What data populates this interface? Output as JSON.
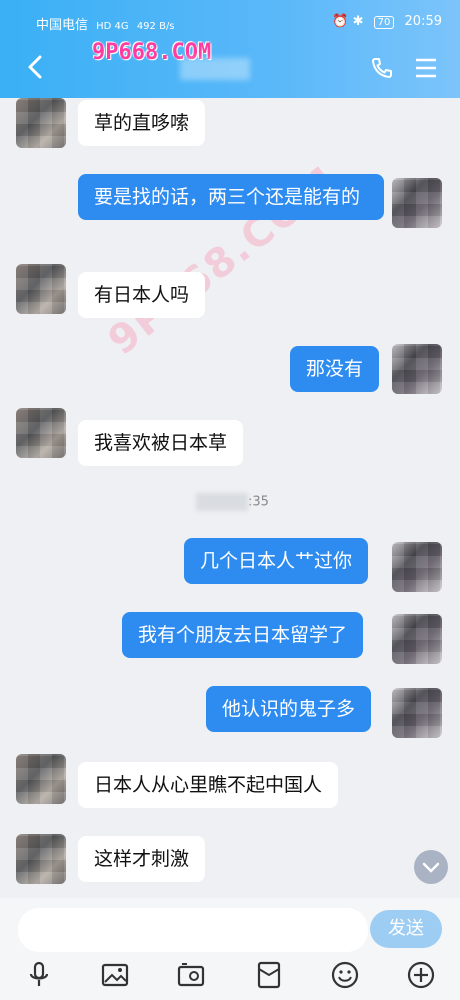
{
  "status_bar": {
    "carrier": "中国电信",
    "network": "HD 4G",
    "speed": "492 B/s",
    "battery": "70",
    "time": "20:59"
  },
  "header": {
    "watermark": "9P668.COM",
    "icons": [
      "back-arrow-icon",
      "phone-icon",
      "menu-icon"
    ]
  },
  "messages": [
    {
      "side": "in",
      "text": "草的直哆嗦"
    },
    {
      "side": "out",
      "text": "要是找的话，两三个还是能有的"
    },
    {
      "side": "in",
      "text": "有日本人吗"
    },
    {
      "side": "out",
      "text": "那没有"
    },
    {
      "side": "in",
      "text": "我喜欢被日本草"
    },
    {
      "side": "out",
      "text": "几个日本人艹过你"
    },
    {
      "side": "out",
      "text": "我有个朋友去日本留学了"
    },
    {
      "side": "out",
      "text": "他认识的鬼子多"
    },
    {
      "side": "in",
      "text": "日本人从心里瞧不起中国人"
    },
    {
      "side": "in",
      "text": "这样才刺激"
    }
  ],
  "timestamp_suffix": ":35",
  "watermark_diag": "9P668.COM",
  "input": {
    "placeholder": "",
    "send_label": "发送"
  },
  "toolbar": [
    "microphone-icon",
    "image-icon",
    "camera-icon",
    "red-packet-icon",
    "emoji-icon",
    "plus-icon"
  ],
  "colors": {
    "header": "#4fb4f7",
    "out_bubble": "#2e8cf0",
    "send": "#9ecdf3"
  }
}
